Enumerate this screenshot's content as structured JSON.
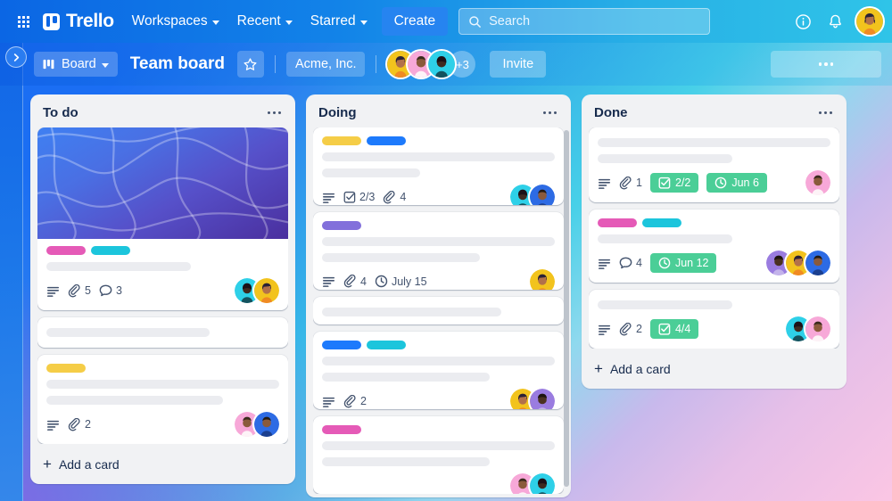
{
  "topnav": {
    "apps_icon": "grid-apps-icon",
    "brand": "Trello",
    "items": [
      {
        "label": "Workspaces",
        "has_caret": true
      },
      {
        "label": "Recent",
        "has_caret": true
      },
      {
        "label": "Starred",
        "has_caret": true
      }
    ],
    "create_label": "Create",
    "search": {
      "placeholder": "Search",
      "value": "",
      "icon": "search-icon"
    },
    "info_icon": "info-circle-icon",
    "bell_icon": "notification-bell-icon",
    "account_avatar": "user-avatar"
  },
  "boardbar": {
    "sidebar_toggle_icon": "chevron-right-icon",
    "view_label": "Board",
    "view_icon": "board-columns-icon",
    "view_caret": true,
    "title": "Team board",
    "star_icon": "star-outline-icon",
    "workspace": "Acme, Inc.",
    "members_overflow": "+3",
    "invite_label": "Invite",
    "overflow_icon": "more-options-icon"
  },
  "colors": {
    "label_pink": "#e55ab7",
    "label_cyan": "#1cc5dc",
    "label_yellow": "#f5cd47",
    "label_blue": "#1d7afc",
    "label_purple": "#8270db",
    "green_badge": "#4bce97",
    "card_bg": "#ffffff",
    "list_bg": "#f1f2f4",
    "skeleton": "#ebecf0",
    "text": "#172b4d",
    "subtle_text": "#44546f"
  },
  "lists": [
    {
      "title": "To do",
      "menu_icon": "list-actions-icon",
      "add_card_label": "Add a card",
      "has_scrollbar": false,
      "cards": [
        {
          "cover": true,
          "labels": [
            "label_pink",
            "label_cyan"
          ],
          "skeleton_lines": [
            62
          ],
          "badges": [
            {
              "type": "description",
              "icon": "description-icon"
            },
            {
              "type": "attachment",
              "icon": "attachment-icon",
              "text": "5"
            },
            {
              "type": "comment",
              "icon": "comment-icon",
              "text": "3"
            }
          ],
          "avatars": [
            "teal-dark",
            "yellow"
          ]
        },
        {
          "cover": false,
          "labels": [],
          "skeleton_lines": [
            70
          ],
          "badges": [],
          "avatars": []
        },
        {
          "cover": false,
          "labels": [
            "label_yellow"
          ],
          "skeleton_lines": [
            100,
            76
          ],
          "badges": [
            {
              "type": "description",
              "icon": "description-icon"
            },
            {
              "type": "attachment",
              "icon": "attachment-icon",
              "text": "2"
            }
          ],
          "avatars": [
            "pink",
            "blue"
          ]
        }
      ]
    },
    {
      "title": "Doing",
      "menu_icon": "list-actions-icon",
      "add_card_label": "",
      "has_scrollbar": true,
      "cards": [
        {
          "cover": false,
          "labels": [
            "label_yellow",
            "label_blue"
          ],
          "skeleton_lines": [
            100,
            42
          ],
          "badges": [
            {
              "type": "description",
              "icon": "description-icon"
            },
            {
              "type": "checklist",
              "icon": "checklist-icon",
              "text": "2/3"
            },
            {
              "type": "attachment",
              "icon": "attachment-icon",
              "text": "4"
            }
          ],
          "avatars": [
            "teal-dark",
            "blue"
          ]
        },
        {
          "cover": false,
          "labels": [
            "label_purple"
          ],
          "skeleton_lines": [
            100,
            68
          ],
          "badges": [
            {
              "type": "description",
              "icon": "description-icon"
            },
            {
              "type": "attachment",
              "icon": "attachment-icon",
              "text": "4"
            },
            {
              "type": "due-date",
              "icon": "clock-icon",
              "text": "July 15"
            }
          ],
          "avatars": [
            "yellow"
          ]
        },
        {
          "cover": false,
          "labels": [],
          "skeleton_lines": [
            77
          ],
          "badges": [],
          "avatars": []
        },
        {
          "cover": false,
          "labels": [
            "label_blue",
            "label_cyan"
          ],
          "skeleton_lines": [
            100,
            72
          ],
          "badges": [
            {
              "type": "description",
              "icon": "description-icon"
            },
            {
              "type": "attachment",
              "icon": "attachment-icon",
              "text": "2"
            }
          ],
          "avatars": [
            "yellow",
            "purple"
          ]
        },
        {
          "cover": false,
          "labels": [
            "label_pink"
          ],
          "skeleton_lines": [
            100,
            72
          ],
          "badges": [],
          "avatars": [
            "pink",
            "teal-dark"
          ]
        }
      ]
    },
    {
      "title": "Done",
      "menu_icon": "list-actions-icon",
      "add_card_label": "Add a card",
      "has_scrollbar": false,
      "cards": [
        {
          "cover": false,
          "labels": [],
          "skeleton_lines": [
            100,
            58
          ],
          "badges": [
            {
              "type": "description",
              "icon": "description-icon"
            },
            {
              "type": "attachment",
              "icon": "attachment-icon",
              "text": "1"
            },
            {
              "type": "checklist-complete",
              "icon": "checklist-icon",
              "text": "2/2"
            },
            {
              "type": "due-date-complete",
              "icon": "clock-icon",
              "text": "Jun 6"
            }
          ],
          "avatars": [
            "pink"
          ]
        },
        {
          "cover": false,
          "labels": [
            "label_pink",
            "label_cyan"
          ],
          "skeleton_lines": [
            58
          ],
          "badges": [
            {
              "type": "description",
              "icon": "description-icon"
            },
            {
              "type": "comment",
              "icon": "comment-icon",
              "text": "4"
            },
            {
              "type": "due-date-complete",
              "icon": "clock-icon",
              "text": "Jun 12"
            }
          ],
          "avatars": [
            "purple",
            "yellow",
            "blue"
          ]
        },
        {
          "cover": false,
          "labels": [],
          "skeleton_lines": [
            58
          ],
          "badges": [
            {
              "type": "description",
              "icon": "description-icon"
            },
            {
              "type": "attachment",
              "icon": "attachment-icon",
              "text": "2"
            },
            {
              "type": "checklist-complete",
              "icon": "checklist-icon",
              "text": "4/4"
            }
          ],
          "avatars": [
            "teal-dark",
            "pink"
          ]
        }
      ]
    }
  ]
}
